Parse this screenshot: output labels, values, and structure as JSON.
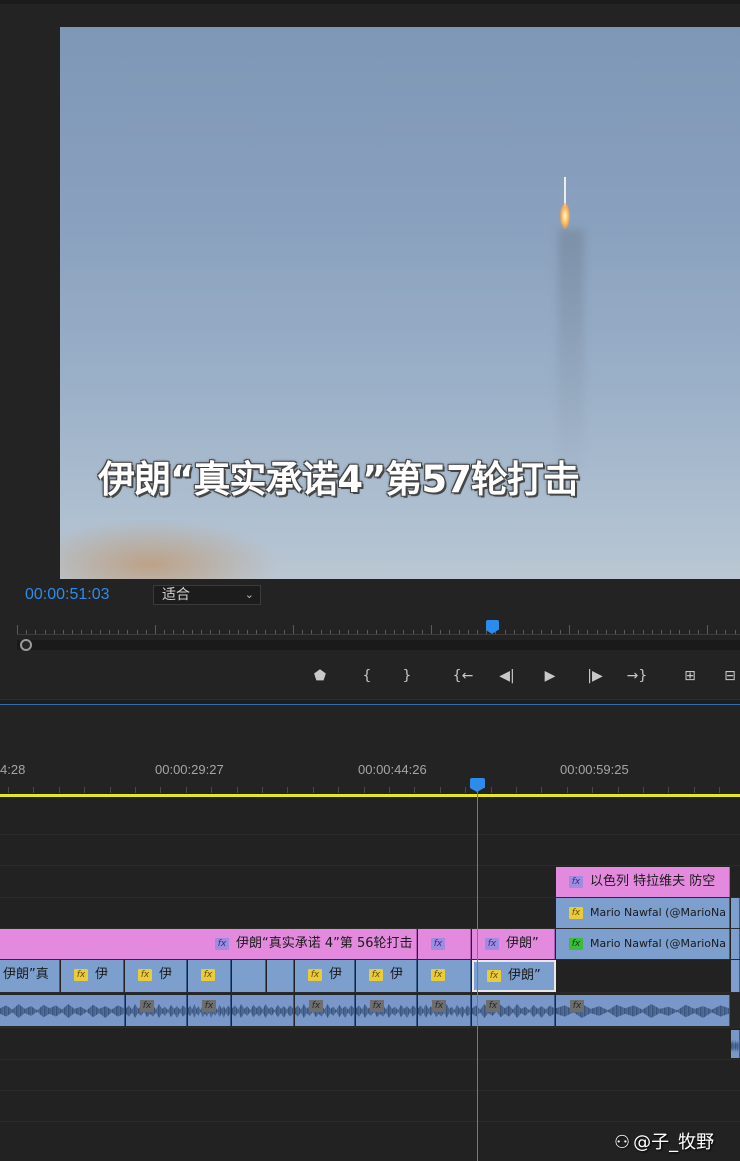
{
  "program_monitor": {
    "caption": "伊朗“真实承诺4”第57轮打击",
    "timecode": "00:00:51:03",
    "fit_select": {
      "value": "适合"
    },
    "transport_icons": [
      "add-marker-icon",
      "mark-in-icon",
      "mark-out-icon",
      "go-to-in-icon",
      "step-back-icon",
      "play-icon",
      "step-forward-icon",
      "go-to-out-icon",
      "lift-icon",
      "extract-icon"
    ],
    "transport_glyphs": {
      "marker": "⬟",
      "mark_in": "{",
      "mark_out": "}",
      "go_in": "{←",
      "step_back": "◀|",
      "play": "▶",
      "step_fwd": "|▶",
      "go_out": "→}",
      "lift": "⊞",
      "extract": "⊟"
    }
  },
  "timeline": {
    "ruler_labels": [
      "4:28",
      "00:00:29:27",
      "00:00:44:26",
      "00:00:59:25"
    ],
    "tracks": {
      "v4": [
        {
          "label": "以色列 特拉维夫 防空",
          "color": "pink",
          "fx": "purple"
        }
      ],
      "v3": [
        {
          "label": "Mario Nawfal (@MarioNa",
          "color": "blue",
          "fx": "yellow"
        }
      ],
      "v2": [
        {
          "label": "伊朗“真实承诺 4”第 56轮打击",
          "color": "pink",
          "fx": "purple"
        },
        {
          "label": "",
          "color": "pink",
          "fx": "purple"
        },
        {
          "label": "伊朗”",
          "color": "pink",
          "fx": "purple"
        },
        {
          "label": "Mario Nawfal (@MarioNa",
          "color": "blue",
          "fx": "green"
        }
      ],
      "v1": [
        {
          "label": "伊朗”真",
          "color": "blue",
          "fx": ""
        },
        {
          "label": "伊",
          "color": "blue",
          "fx": "yellow"
        },
        {
          "label": "伊",
          "color": "blue",
          "fx": "yellow"
        },
        {
          "label": "",
          "color": "blue",
          "fx": "yellow"
        },
        {
          "label": "",
          "color": "blue",
          "fx": ""
        },
        {
          "label": "",
          "color": "blue",
          "fx": ""
        },
        {
          "label": "伊",
          "color": "blue",
          "fx": "yellow"
        },
        {
          "label": "伊",
          "color": "blue",
          "fx": "yellow"
        },
        {
          "label": "",
          "color": "blue",
          "fx": "yellow"
        },
        {
          "label": "伊朗”",
          "color": "blue",
          "fx": "yellow",
          "selected": true
        }
      ]
    },
    "fx_glyph": "fx"
  },
  "watermark": {
    "logo": "⚇",
    "text": "@子_牧野"
  },
  "colors": {
    "accent_blue": "#2d8ceb",
    "work_area": "#e7e722",
    "clip_pink": "#e38adf",
    "clip_blue": "#7c9fce"
  }
}
